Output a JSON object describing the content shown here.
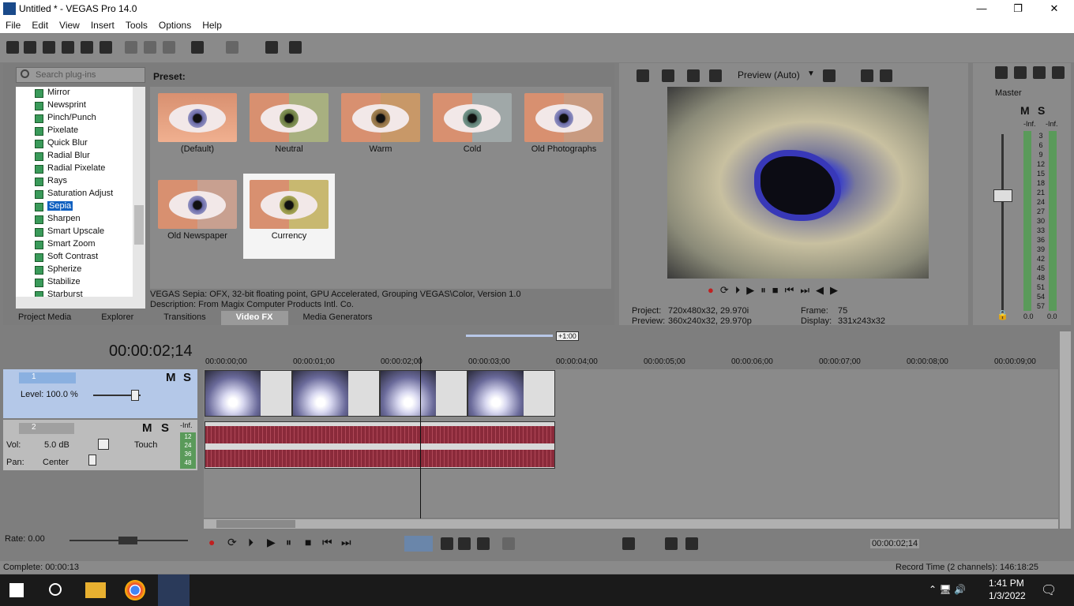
{
  "window": {
    "title": "Untitled * - VEGAS Pro 14.0",
    "min": "—",
    "max": "❐",
    "close": "✕"
  },
  "menu": [
    "File",
    "Edit",
    "View",
    "Insert",
    "Tools",
    "Options",
    "Help"
  ],
  "plugins": {
    "search_placeholder": "Search plug-ins",
    "items": [
      "Mirror",
      "Newsprint",
      "Pinch/Punch",
      "Pixelate",
      "Quick Blur",
      "Radial Blur",
      "Radial Pixelate",
      "Rays",
      "Saturation Adjust",
      "Sepia",
      "Sharpen",
      "Smart Upscale",
      "Smart Zoom",
      "Soft Contrast",
      "Spherize",
      "Stabilize",
      "Starburst"
    ],
    "selected": "Sepia"
  },
  "presets": {
    "label": "Preset:",
    "items": [
      "(Default)",
      "Neutral",
      "Warm",
      "Cold",
      "Old Photographs",
      "Old Newspaper",
      "Currency"
    ],
    "selected": "Currency"
  },
  "fxinfo": {
    "line1": "VEGAS Sepia: OFX, 32-bit floating point, GPU Accelerated, Grouping VEGAS\\Color, Version 1.0",
    "line2": "Description: From Magix Computer Products Intl. Co."
  },
  "tabs": [
    "Project Media",
    "Explorer",
    "Transitions",
    "Video FX",
    "Media Generators"
  ],
  "active_tab": "Video FX",
  "preview": {
    "mode": "Preview (Auto)",
    "project_label": "Project:",
    "project": "720x480x32, 29.970i",
    "preview_label": "Preview:",
    "preview": "360x240x32, 29.970p",
    "frame_label": "Frame:",
    "frame": "75",
    "display_label": "Display:",
    "display": "331x243x32"
  },
  "mixer": {
    "master": "Master",
    "m": "M",
    "s": "S",
    "inf_l": "-Inf.",
    "inf_r": "-Inf.",
    "scale": [
      "3",
      "6",
      "9",
      "12",
      "15",
      "18",
      "21",
      "24",
      "27",
      "30",
      "33",
      "36",
      "39",
      "42",
      "45",
      "48",
      "51",
      "54",
      "57"
    ],
    "val_l": "0.0",
    "val_r": "0.0"
  },
  "timeline": {
    "timecode": "00:00:02;14",
    "zoom": "+1:00",
    "ruler": [
      "00:00:00;00",
      "00:00:01;00",
      "00:00:02;00",
      "00:00:03;00",
      "00:00:04;00",
      "00:00:05;00",
      "00:00:06;00",
      "00:00:07;00",
      "00:00:08;00",
      "00:00:09;00"
    ]
  },
  "track1": {
    "num": "1",
    "level_label": "Level: 100.0 %",
    "m": "M",
    "s": "S"
  },
  "track2": {
    "num": "2",
    "vol_label": "Vol:",
    "vol": "5.0 dB",
    "touch": "Touch",
    "pan_label": "Pan:",
    "pan": "Center",
    "m": "M",
    "s": "S",
    "inf": "-Inf.",
    "meter": [
      "12",
      "24",
      "36",
      "48"
    ]
  },
  "transport": {
    "rate": "Rate: 0.00",
    "cursor": "00:00:02;14"
  },
  "status": {
    "left": "Complete: 00:00:13",
    "right": "Record Time (2 channels): 146:18:25"
  },
  "taskbar": {
    "time": "1:41 PM",
    "date": "1/3/2022"
  }
}
